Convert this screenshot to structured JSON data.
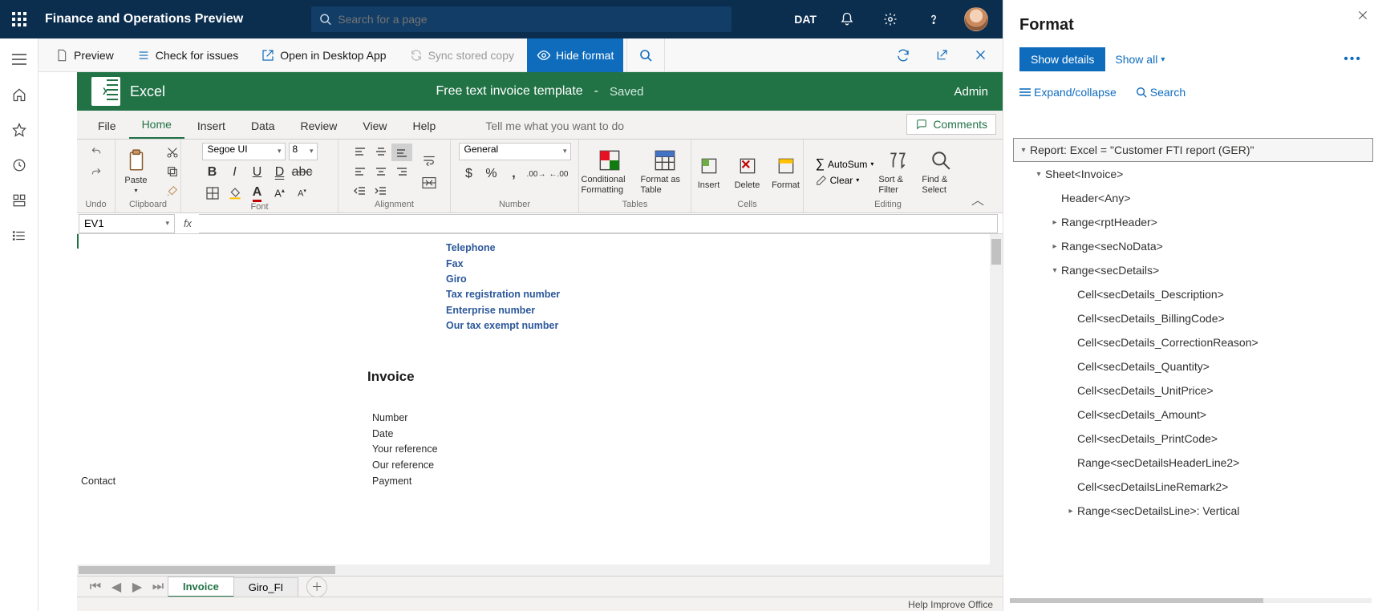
{
  "header": {
    "app_title": "Finance and Operations Preview",
    "search_placeholder": "Search for a page",
    "company": "DAT"
  },
  "action_bar": {
    "preview": "Preview",
    "check_issues": "Check for issues",
    "open_desktop": "Open in Desktop App",
    "sync": "Sync stored copy",
    "hide_format": "Hide format"
  },
  "excel": {
    "app_name": "Excel",
    "doc_name": "Free text invoice template",
    "separator": "-",
    "saved": "Saved",
    "user": "Admin",
    "tabs": {
      "file": "File",
      "home": "Home",
      "insert": "Insert",
      "data": "Data",
      "review": "Review",
      "view": "View",
      "help": "Help",
      "tellme": "Tell me what you want to do",
      "comments": "Comments"
    },
    "ribbon": {
      "undo": "Undo",
      "clipboard": "Clipboard",
      "paste": "Paste",
      "font": "Font",
      "font_name": "Segoe UI",
      "font_size": "8",
      "alignment": "Alignment",
      "number": "Number",
      "number_format": "General",
      "tables": "Tables",
      "cond_fmt": "Conditional Formatting",
      "fmt_table": "Format as Table",
      "cells": "Cells",
      "insert_btn": "Insert",
      "delete_btn": "Delete",
      "format_btn": "Format",
      "editing": "Editing",
      "autosum": "AutoSum",
      "clear": "Clear",
      "sortfilter": "Sort & Filter",
      "findselect": "Find & Select"
    },
    "name_box": "EV1",
    "sheet": {
      "telephone": "Telephone",
      "fax": "Fax",
      "giro": "Giro",
      "tax_reg": "Tax registration number",
      "enterprise": "Enterprise number",
      "tax_exempt": "Our tax exempt number",
      "invoice_title": "Invoice",
      "number": "Number",
      "date": "Date",
      "your_ref": "Your reference",
      "our_ref": "Our reference",
      "payment": "Payment",
      "contact": "Contact"
    },
    "sheet_tabs": {
      "invoice": "Invoice",
      "giro_fi": "Giro_FI"
    },
    "status": "Help Improve Office"
  },
  "format_panel": {
    "title": "Format",
    "show_details": "Show details",
    "show_all": "Show all",
    "expand": "Expand/collapse",
    "search": "Search",
    "tree": {
      "root": "Report: Excel = \"Customer FTI report (GER)\"",
      "sheet": "Sheet<Invoice>",
      "header": "Header<Any>",
      "rptHeader": "Range<rptHeader>",
      "secNoData": "Range<secNoData>",
      "secDetails": "Range<secDetails>",
      "c_desc": "Cell<secDetails_Description>",
      "c_bill": "Cell<secDetails_BillingCode>",
      "c_corr": "Cell<secDetails_CorrectionReason>",
      "c_qty": "Cell<secDetails_Quantity>",
      "c_unit": "Cell<secDetails_UnitPrice>",
      "c_amt": "Cell<secDetails_Amount>",
      "c_print": "Cell<secDetails_PrintCode>",
      "r_hdr2": "Range<secDetailsHeaderLine2>",
      "c_rem2": "Cell<secDetailsLineRemark2>",
      "r_line": "Range<secDetailsLine>: Vertical"
    }
  }
}
